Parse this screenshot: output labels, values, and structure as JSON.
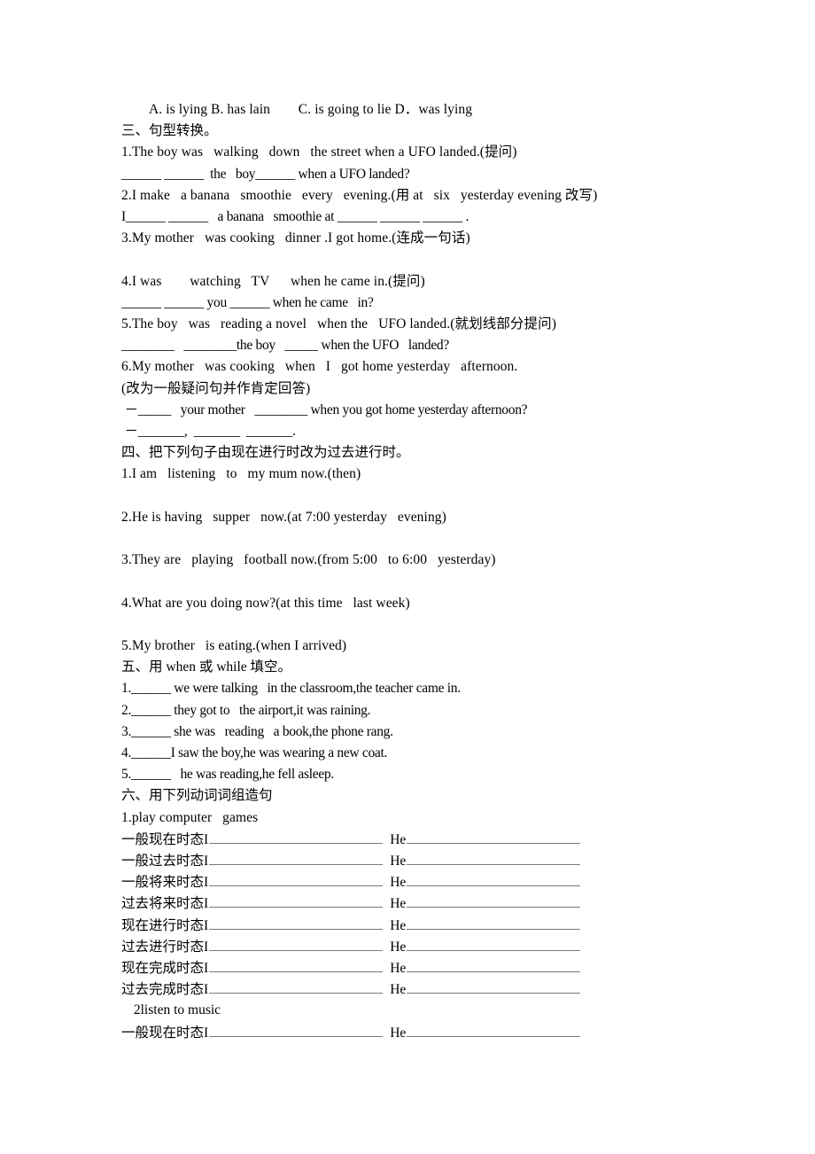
{
  "document": {
    "type": "worksheet",
    "language": "zh-CN + en",
    "multiple_choice_tail": "        A. is lying B. has lain        C. is going to lie D．was lying",
    "sections": [
      {
        "id": "section-3",
        "heading": "三、句型转换。",
        "lines": [
          "1.The boy was   walking   down   the street when a UFO landed.(提问)",
          "______ ______  the   boy______ when a UFO landed?",
          "2.I make   a banana   smoothie   every   evening.(用 at   six   yesterday evening 改写)",
          "I______ ______   a banana   smoothie at ______ ______ ______ .",
          "3.My mother   was cooking   dinner .I got home.(连成一句话)",
          "",
          "4.I was        watching   TV      when he came in.(提问)",
          "______ ______ you ______ when he came   in?",
          "5.The boy   was   reading a novel   when the   UFO landed.(就划线部分提问)",
          "________   ________the boy   _____ when the UFO   landed?",
          "6.My mother   was cooking   when   I   got home yesterday   afternoon.",
          "(改为一般疑问句并作肯定回答)",
          " －_____   your mother   ________ when you got home yesterday afternoon?",
          " －_______,  _______  _______."
        ]
      },
      {
        "id": "section-4",
        "heading": "四、把下列句子由现在进行时改为过去进行时。",
        "lines": [
          "1.I am   listening   to   my mum now.(then)",
          "",
          "2.He is having   supper   now.(at 7:00 yesterday   evening)",
          "",
          "3.They are   playing   football now.(from 5:00   to 6:00   yesterday)",
          "",
          "4.What are you doing now?(at this time   last week)",
          "",
          "5.My brother   is eating.(when I arrived)"
        ]
      },
      {
        "id": "section-5",
        "heading": "五、用 when 或 while 填空。",
        "lines": [
          "1.______ we were talking   in the classroom,the teacher came in.",
          "2.______ they got to   the airport,it was raining.",
          "3.______ she was   reading   a book,the phone rang.",
          "4.______I saw the boy,he was wearing a new coat.",
          "5.______   he was reading,he fell asleep."
        ]
      },
      {
        "id": "section-6",
        "heading": "六、用下列动词词组造句",
        "items": [
          {
            "label": "1.play computer   games",
            "rows": [
              "一般现在时态",
              "一般过去时态",
              "一般将来时态",
              "过去将来时态",
              "现在进行时态",
              "过去进行时态",
              "现在完成时态",
              "过去完成时态"
            ]
          },
          {
            "label": " 2listen to music",
            "rows": [
              "一般现在时态"
            ]
          }
        ],
        "subject_i": "I",
        "subject_he": "He"
      }
    ]
  }
}
